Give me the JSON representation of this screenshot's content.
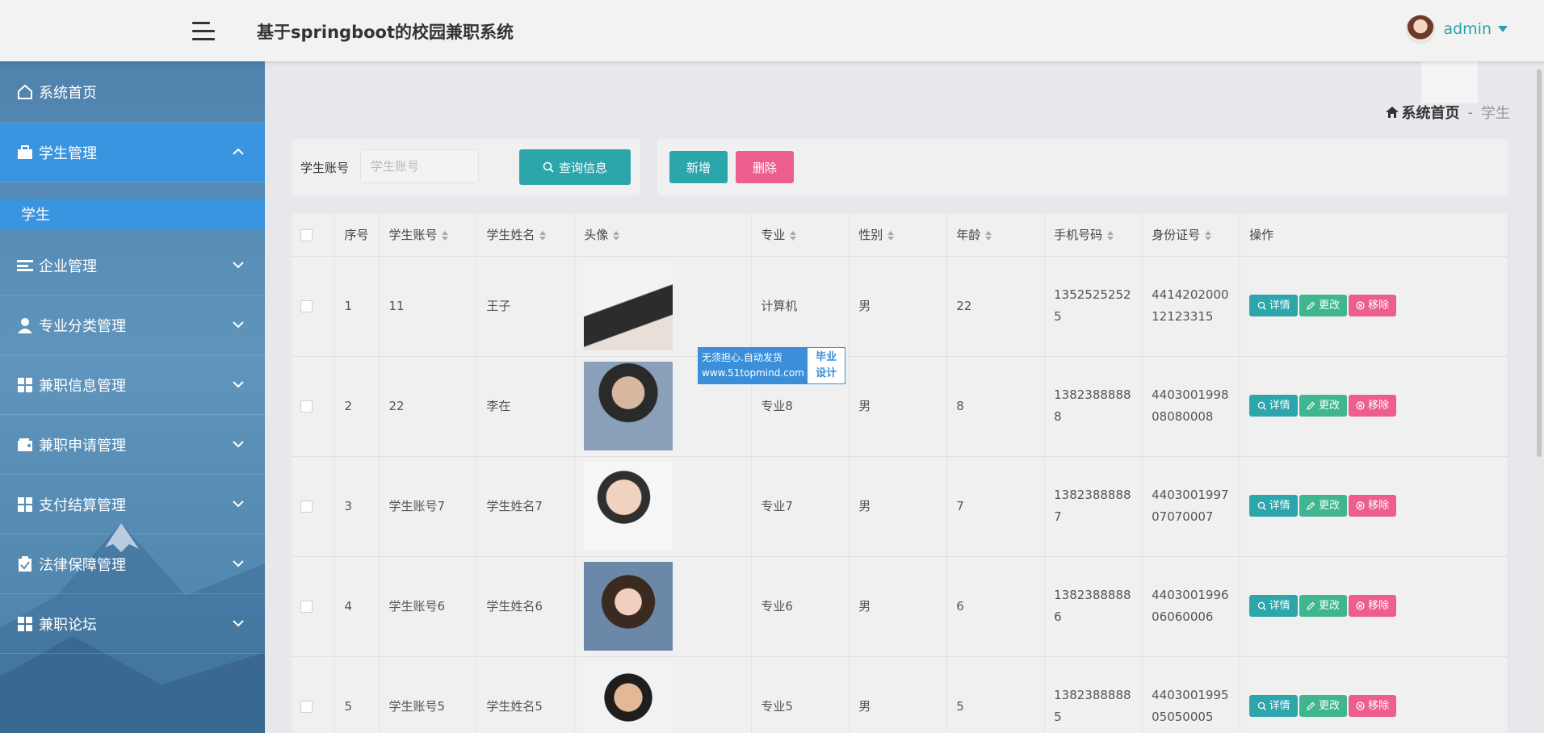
{
  "header": {
    "app_title": "基于springboot的校园兼职系统",
    "user_name": "admin"
  },
  "sidebar": {
    "items": [
      {
        "label": "系统首页",
        "icon": "home-icon"
      },
      {
        "label": "学生管理",
        "icon": "briefcase-icon",
        "expanded": true
      },
      {
        "label": "企业管理",
        "icon": "list-icon"
      },
      {
        "label": "专业分类管理",
        "icon": "user-icon"
      },
      {
        "label": "兼职信息管理",
        "icon": "grid-icon"
      },
      {
        "label": "兼职申请管理",
        "icon": "wallet-icon"
      },
      {
        "label": "支付结算管理",
        "icon": "grid-icon"
      },
      {
        "label": "法律保障管理",
        "icon": "clipboard-check-icon"
      },
      {
        "label": "兼职论坛",
        "icon": "grid-icon"
      }
    ],
    "sub_items": [
      {
        "label": "学生"
      }
    ]
  },
  "breadcrumb": {
    "home": "系统首页",
    "separator": "-",
    "current": "学生"
  },
  "search": {
    "label": "学生账号",
    "placeholder": "学生账号",
    "button_label": "查询信息"
  },
  "actions": {
    "add_label": "新增",
    "delete_label": "删除"
  },
  "table": {
    "columns": [
      "序号",
      "学生账号",
      "学生姓名",
      "头像",
      "专业",
      "性别",
      "年龄",
      "手机号码",
      "身份证号",
      "操作"
    ],
    "rows": [
      {
        "no": "1",
        "account": "11",
        "name": "王子",
        "major": "计算机",
        "gender": "男",
        "age": "22",
        "phone": "1352525252\n5",
        "id_card": "4414202000\n12123315"
      },
      {
        "no": "2",
        "account": "22",
        "name": "李在",
        "major": "专业8",
        "gender": "男",
        "age": "8",
        "phone": "1382388888\n8",
        "id_card": "4403001998\n08080008"
      },
      {
        "no": "3",
        "account": "学生账号7",
        "name": "学生姓名7",
        "major": "专业7",
        "gender": "男",
        "age": "7",
        "phone": "1382388888\n7",
        "id_card": "4403001997\n07070007"
      },
      {
        "no": "4",
        "account": "学生账号6",
        "name": "学生姓名6",
        "major": "专业6",
        "gender": "男",
        "age": "6",
        "phone": "1382388888\n6",
        "id_card": "4403001996\n06060006"
      },
      {
        "no": "5",
        "account": "学生账号5",
        "name": "学生姓名5",
        "major": "专业5",
        "gender": "男",
        "age": "5",
        "phone": "1382388888\n5",
        "id_card": "4403001995\n05050005"
      }
    ],
    "op_labels": {
      "detail": "详情",
      "edit": "更改",
      "remove": "移除"
    }
  },
  "watermark": {
    "line1": "无须担心.自动发货",
    "line2": "www.51topmind.com",
    "right1": "毕业",
    "right2": "设计"
  },
  "colors": {
    "teal": "#2ca5ab",
    "green": "#3fb690",
    "pink": "#ed5e8e",
    "sidebar_active": "#3a95e0"
  }
}
